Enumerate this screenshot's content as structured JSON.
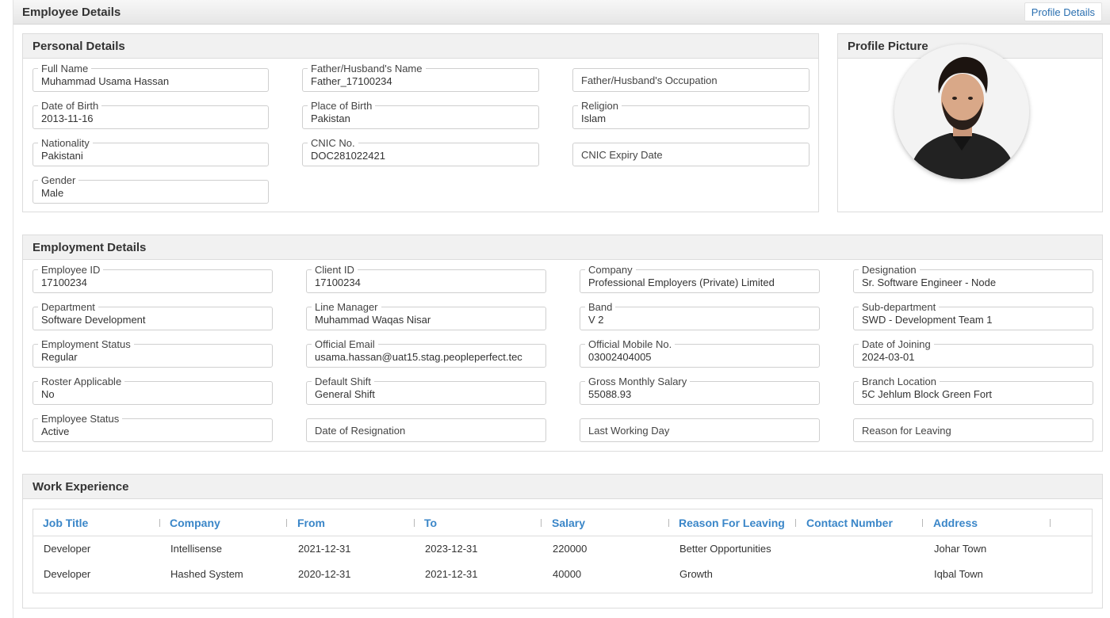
{
  "page": {
    "title": "Employee Details",
    "tab_label": "Profile Details"
  },
  "personal": {
    "heading": "Personal Details",
    "fields": {
      "full_name": {
        "label": "Full Name",
        "value": "Muhammad Usama Hassan"
      },
      "father_name": {
        "label": "Father/Husband's Name",
        "value": "Father_17100234"
      },
      "father_occupation": {
        "label": "Father/Husband's Occupation",
        "value": ""
      },
      "dob": {
        "label": "Date of Birth",
        "value": "2013-11-16"
      },
      "place_of_birth": {
        "label": "Place of Birth",
        "value": "Pakistan"
      },
      "religion": {
        "label": "Religion",
        "value": "Islam"
      },
      "nationality": {
        "label": "Nationality",
        "value": "Pakistani"
      },
      "cnic_no": {
        "label": "CNIC No.",
        "value": "DOC281022421"
      },
      "cnic_expiry": {
        "label": "CNIC Expiry Date",
        "value": ""
      },
      "gender": {
        "label": "Gender",
        "value": "Male"
      }
    }
  },
  "profile_picture": {
    "heading": "Profile Picture"
  },
  "employment": {
    "heading": "Employment Details",
    "fields": {
      "employee_id": {
        "label": "Employee ID",
        "value": "17100234"
      },
      "client_id": {
        "label": "Client ID",
        "value": "17100234"
      },
      "company": {
        "label": "Company",
        "value": "Professional Employers (Private) Limited"
      },
      "designation": {
        "label": "Designation",
        "value": "Sr. Software Engineer - Node"
      },
      "department": {
        "label": "Department",
        "value": "Software Development"
      },
      "line_manager": {
        "label": "Line Manager",
        "value": "Muhammad Waqas Nisar"
      },
      "band": {
        "label": "Band",
        "value": "V 2"
      },
      "sub_department": {
        "label": "Sub-department",
        "value": "SWD - Development Team 1"
      },
      "employment_status": {
        "label": "Employment Status",
        "value": "Regular"
      },
      "official_email": {
        "label": "Official Email",
        "value": "usama.hassan@uat15.stag.peopleperfect.tec"
      },
      "official_mobile": {
        "label": "Official Mobile No.",
        "value": "03002404005"
      },
      "date_of_joining": {
        "label": "Date of Joining",
        "value": "2024-03-01"
      },
      "roster_applicable": {
        "label": "Roster Applicable",
        "value": "No"
      },
      "default_shift": {
        "label": "Default Shift",
        "value": "General Shift"
      },
      "gross_salary": {
        "label": "Gross Monthly Salary",
        "value": "55088.93"
      },
      "branch_location": {
        "label": "Branch Location",
        "value": "5C Jehlum Block Green Fort"
      },
      "employee_status": {
        "label": "Employee Status",
        "value": "Active"
      },
      "date_of_resignation": {
        "label": "Date of Resignation",
        "value": ""
      },
      "last_working_day": {
        "label": "Last Working Day",
        "value": ""
      },
      "reason_for_leaving": {
        "label": "Reason for Leaving",
        "value": ""
      }
    }
  },
  "work_experience": {
    "heading": "Work Experience",
    "columns": [
      "Job Title",
      "Company",
      "From",
      "To",
      "Salary",
      "Reason For Leaving",
      "Contact Number",
      "Address"
    ],
    "rows": [
      [
        "Developer",
        "Intellisense",
        "2021-12-31",
        "2023-12-31",
        "220000",
        "Better Opportunities",
        "",
        "Johar Town"
      ],
      [
        "Developer",
        "Hashed System",
        "2020-12-31",
        "2021-12-31",
        "40000",
        "Growth",
        "",
        "Iqbal Town"
      ]
    ]
  }
}
